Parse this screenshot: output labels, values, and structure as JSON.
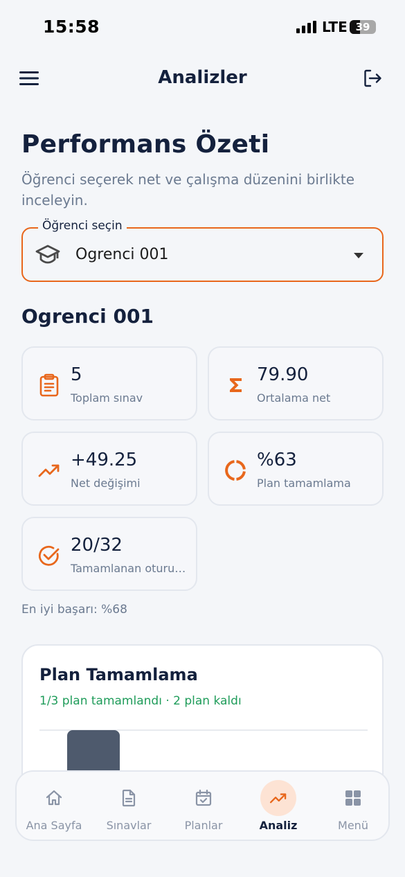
{
  "status_bar": {
    "time": "15:58",
    "network": "LTE",
    "battery": "39",
    "battery_level": 0.39
  },
  "header": {
    "title": "Analizler",
    "menu_icon": "hamburger-menu-icon",
    "logout_icon": "logout-icon"
  },
  "page": {
    "title": "Performans Özeti",
    "subtitle": "Öğrenci seçerek net ve çalışma düzenini birlikte inceleyin."
  },
  "student_select": {
    "label": "Öğrenci seçin",
    "value": "Ogrenci 001",
    "icon": "graduation-cap-icon"
  },
  "student_name": "Ogrenci 001",
  "stats": [
    {
      "value": "5",
      "label": "Toplam sınav",
      "icon": "clipboard-icon"
    },
    {
      "value": "79.90",
      "label": "Ortalama net",
      "icon": "sigma-icon"
    },
    {
      "value": "+49.25",
      "label": "Net değişimi",
      "icon": "trending-up-icon"
    },
    {
      "value": "%63",
      "label": "Plan tamamlama",
      "icon": "donut-progress-icon"
    },
    {
      "value": "20/32",
      "label": "Tamamlanan oturumlar",
      "icon": "check-circle-icon"
    }
  ],
  "best_text": "En iyi başarı: %68",
  "plan_card": {
    "title": "Plan Tamamlama",
    "subtitle": "1/3 plan tamamlandı · 2 plan kaldı"
  },
  "colors": {
    "accent": "#e8671c",
    "text": "#14213d",
    "muted": "#6b7a90",
    "success": "#1f9c5a",
    "bar": "#4e5a6d"
  },
  "nav": [
    {
      "label": "Ana Sayfa",
      "icon": "home-icon",
      "active": false
    },
    {
      "label": "Sınavlar",
      "icon": "document-icon",
      "active": false
    },
    {
      "label": "Planlar",
      "icon": "calendar-check-icon",
      "active": false
    },
    {
      "label": "Analiz",
      "icon": "trending-up-icon",
      "active": true
    },
    {
      "label": "Menü",
      "icon": "grid-icon",
      "active": false
    }
  ]
}
